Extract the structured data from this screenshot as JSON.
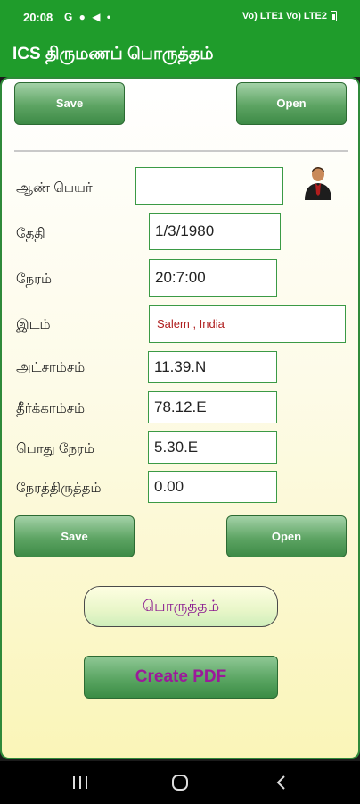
{
  "status_bar": {
    "time": "20:08",
    "left_icons": "G ● ◀ •",
    "right_icons": "Vo) LTE1 Vo) LTE2"
  },
  "app": {
    "title": "ICS திருமணப் பொருத்தம்"
  },
  "top_buttons": {
    "save": "Save",
    "open": "Open"
  },
  "form": {
    "name_label": "ஆண் பெயர்",
    "name_value": "",
    "date_label": "தேதி",
    "date_value": "1/3/1980",
    "time_label": "நேரம்",
    "time_value": "20:7:00",
    "place_label": "இடம்",
    "place_value": "Salem , India",
    "latitude_label": "அட்சாம்சம்",
    "latitude_value": "11.39.N",
    "longitude_label": "தீர்க்காம்சம்",
    "longitude_value": "78.12.E",
    "timezone_label": "பொது நேரம்",
    "timezone_value": "5.30.E",
    "correction_label": "நேரத்திருத்தம்",
    "correction_value": "0.00"
  },
  "bottom_buttons": {
    "save": "Save",
    "open": "Open"
  },
  "actions": {
    "porutham": "பொருத்தம்",
    "create_pdf": "Create PDF"
  },
  "icons": {
    "avatar": "person-avatar-icon",
    "nav": [
      "recents-icon",
      "home-icon",
      "back-icon"
    ]
  },
  "colors": {
    "accent": "#1f9c2b",
    "button_green": "#5da463",
    "pdf_text": "#9b1a9a",
    "place_text": "#b02020"
  }
}
